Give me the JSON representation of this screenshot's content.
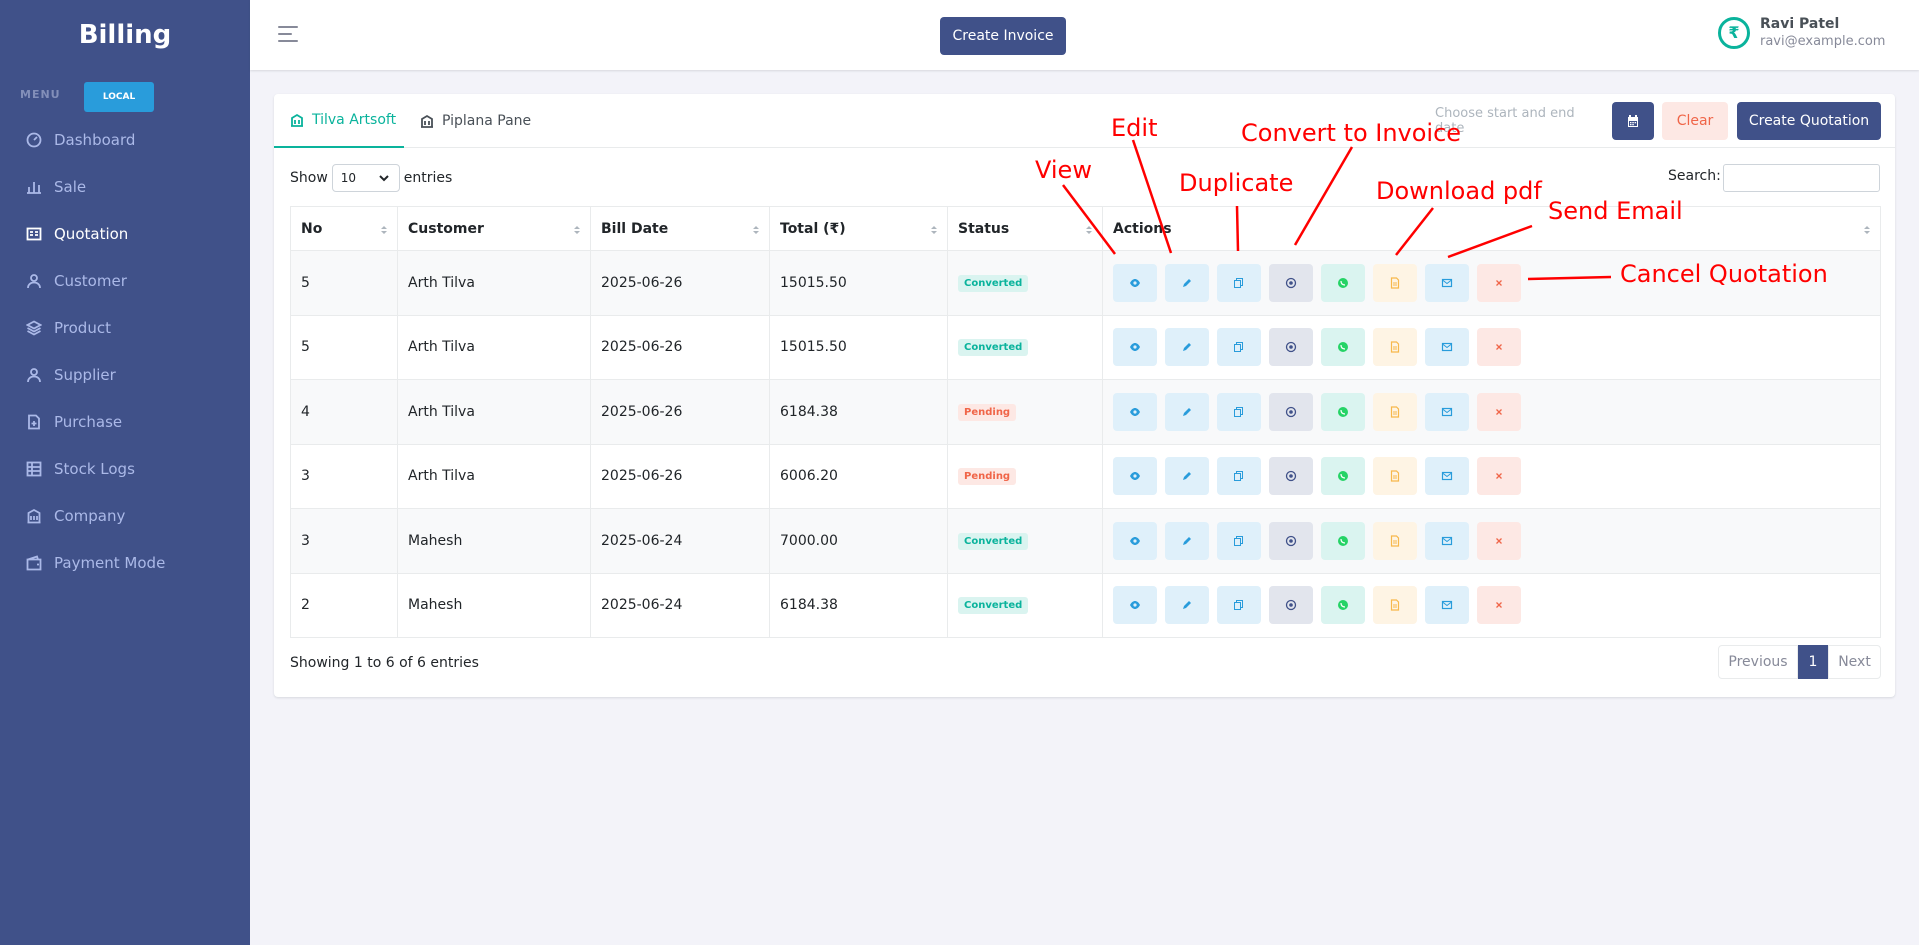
{
  "sidebar": {
    "brand": "Billing",
    "menu_title": "MENU",
    "env_badge": "LOCAL",
    "items": [
      {
        "label": "Dashboard",
        "icon": "dashboard-icon"
      },
      {
        "label": "Sale",
        "icon": "bar-chart-icon"
      },
      {
        "label": "Quotation",
        "icon": "document-icon",
        "active": true
      },
      {
        "label": "Customer",
        "icon": "user-icon"
      },
      {
        "label": "Product",
        "icon": "layers-icon"
      },
      {
        "label": "Supplier",
        "icon": "user-icon"
      },
      {
        "label": "Purchase",
        "icon": "file-plus-icon"
      },
      {
        "label": "Stock Logs",
        "icon": "table-icon"
      },
      {
        "label": "Company",
        "icon": "building-icon"
      },
      {
        "label": "Payment Mode",
        "icon": "wallet-icon"
      }
    ]
  },
  "header": {
    "create_invoice_label": "Create Invoice",
    "user": {
      "name": "Ravi Patel",
      "email": "ravi@example.com",
      "avatar_symbol": "₹"
    }
  },
  "tabs": [
    {
      "label": "Tilva Artsoft",
      "active": true
    },
    {
      "label": "Piplana Pane",
      "active": false
    }
  ],
  "filters": {
    "date_placeholder": "Choose start and end date",
    "clear_label": "Clear",
    "create_quotation_label": "Create Quotation"
  },
  "table_controls": {
    "show_label": "Show",
    "entries_value": "10",
    "entries_label": "entries",
    "search_label": "Search:"
  },
  "table": {
    "columns": [
      "No",
      "Customer",
      "Bill Date",
      "Total (₹)",
      "Status",
      "Actions"
    ],
    "rows": [
      {
        "no": "5",
        "customer": "Arth Tilva",
        "bill_date": "2025-06-26",
        "total": "15015.50",
        "status": "Converted"
      },
      {
        "no": "5",
        "customer": "Arth Tilva",
        "bill_date": "2025-06-26",
        "total": "15015.50",
        "status": "Converted"
      },
      {
        "no": "4",
        "customer": "Arth Tilva",
        "bill_date": "2025-06-26",
        "total": "6184.38",
        "status": "Pending"
      },
      {
        "no": "3",
        "customer": "Arth Tilva",
        "bill_date": "2025-06-26",
        "total": "6006.20",
        "status": "Pending"
      },
      {
        "no": "3",
        "customer": "Mahesh",
        "bill_date": "2025-06-24",
        "total": "7000.00",
        "status": "Converted"
      },
      {
        "no": "2",
        "customer": "Mahesh",
        "bill_date": "2025-06-24",
        "total": "6184.38",
        "status": "Converted"
      }
    ]
  },
  "footer": {
    "showing_text": "Showing 1 to 6 of 6 entries",
    "prev_label": "Previous",
    "page": "1",
    "next_label": "Next"
  },
  "annotations": {
    "view": "View",
    "edit": "Edit",
    "duplicate": "Duplicate",
    "convert": "Convert to Invoice",
    "download": "Download pdf",
    "email": "Send Email",
    "cancel": "Cancel Quotation"
  },
  "colors": {
    "sidebar": "#405189",
    "primary": "#405189",
    "success": "#0ab39c",
    "danger": "#f06548",
    "annotation": "#ff0000"
  }
}
